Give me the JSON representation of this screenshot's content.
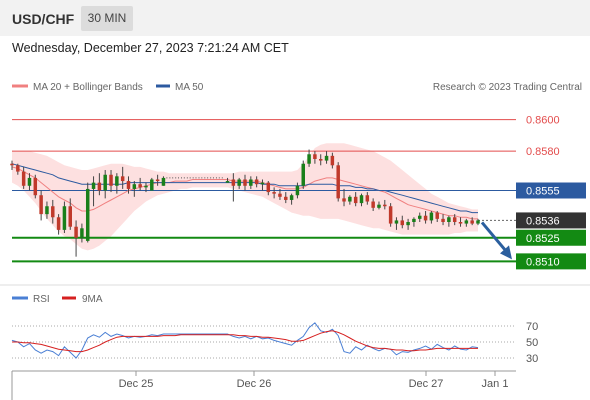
{
  "header": {
    "symbol": "USD/CHF",
    "timeframe": "30 MIN",
    "datetime": "Wednesday, December 27, 2023 7:21:24 AM CET"
  },
  "legend": {
    "bollinger": "MA 20 + Bollinger Bands",
    "ma50": "MA 50",
    "rsi": "RSI",
    "ma9": "9MA"
  },
  "copyright": "Research © 2023 Trading Central",
  "colors": {
    "bollinger": "#f08080",
    "band_fill": "#fde0e0",
    "ma50": "#2c5aa0",
    "support": "#138a13",
    "resistance": "#e34c4c",
    "current": "#333333",
    "candle_up": "#1a7f1a",
    "candle_down": "#c0392b",
    "arrow": "#2b5f9e",
    "rsi": "#4a7fd4",
    "ma9": "#d62020"
  },
  "chart_data": [
    {
      "type": "candlestick",
      "ylim": [
        0.8495,
        0.8615
      ],
      "price_levels": [
        {
          "value": 0.86,
          "label": "0.8600",
          "kind": "resistance"
        },
        {
          "value": 0.858,
          "label": "0.8580",
          "kind": "resistance"
        },
        {
          "value": 0.8555,
          "label": "0.8555",
          "kind": "pivot"
        },
        {
          "value": 0.8536,
          "label": "0.8536",
          "kind": "current"
        },
        {
          "value": 0.8525,
          "label": "0.8525",
          "kind": "support"
        },
        {
          "value": 0.851,
          "label": "0.8510",
          "kind": "support"
        }
      ],
      "x_ticks": [
        "Dec 25",
        "Dec 26",
        "Dec 27",
        "Jan 1"
      ],
      "candles": [
        [
          0.8572,
          0.8574,
          0.8568,
          0.8571
        ],
        [
          0.8571,
          0.8572,
          0.8565,
          0.8567
        ],
        [
          0.8567,
          0.857,
          0.8556,
          0.8558
        ],
        [
          0.8558,
          0.8566,
          0.8555,
          0.8563
        ],
        [
          0.8563,
          0.8565,
          0.855,
          0.8552
        ],
        [
          0.8552,
          0.8555,
          0.8536,
          0.854
        ],
        [
          0.854,
          0.8548,
          0.8537,
          0.8545
        ],
        [
          0.8545,
          0.8549,
          0.8534,
          0.8538
        ],
        [
          0.8538,
          0.854,
          0.8527,
          0.853
        ],
        [
          0.853,
          0.8548,
          0.8528,
          0.8545
        ],
        [
          0.8545,
          0.855,
          0.853,
          0.8532
        ],
        [
          0.8532,
          0.8536,
          0.8513,
          0.8525
        ],
        [
          0.8525,
          0.8534,
          0.8522,
          0.8531
        ],
        [
          0.8523,
          0.856,
          0.8522,
          0.8556
        ],
        [
          0.8556,
          0.8564,
          0.8545,
          0.856
        ],
        [
          0.856,
          0.8566,
          0.8552,
          0.8555
        ],
        [
          0.8555,
          0.8568,
          0.855,
          0.8565
        ],
        [
          0.8565,
          0.8568,
          0.8554,
          0.8558
        ],
        [
          0.8558,
          0.8566,
          0.8553,
          0.8564
        ],
        [
          0.8564,
          0.857,
          0.8556,
          0.8561
        ],
        [
          0.8561,
          0.8564,
          0.8553,
          0.8556
        ],
        [
          0.8556,
          0.8561,
          0.8551,
          0.8559
        ],
        [
          0.8559,
          0.8563,
          0.8555,
          0.8557
        ],
        [
          0.8557,
          0.856,
          0.8554,
          0.8558
        ],
        [
          0.8555,
          0.8563,
          0.8555,
          0.8562
        ],
        [
          0.8562,
          0.8565,
          0.8558,
          0.8561
        ],
        [
          0.8558,
          0.8564,
          0.8558,
          0.8563
        ],
        [
          0.8563,
          0.8563,
          0.8563,
          0.8563
        ],
        [
          0.8563,
          0.8563,
          0.8563,
          0.8563
        ],
        [
          0.8563,
          0.8563,
          0.8563,
          0.8563
        ],
        [
          0.8563,
          0.8563,
          0.8563,
          0.8563
        ],
        [
          0.8563,
          0.8563,
          0.8563,
          0.8563
        ],
        [
          0.8563,
          0.8563,
          0.8563,
          0.8563
        ],
        [
          0.8563,
          0.8563,
          0.8563,
          0.8563
        ],
        [
          0.8563,
          0.8563,
          0.8563,
          0.8563
        ],
        [
          0.8563,
          0.8563,
          0.8563,
          0.8563
        ],
        [
          0.8563,
          0.8563,
          0.8563,
          0.8563
        ],
        [
          0.856,
          0.8563,
          0.856,
          0.8561
        ],
        [
          0.8562,
          0.8566,
          0.8548,
          0.8558
        ],
        [
          0.8558,
          0.8563,
          0.8556,
          0.8562
        ],
        [
          0.8562,
          0.8565,
          0.8555,
          0.8558
        ],
        [
          0.8558,
          0.8564,
          0.8556,
          0.8562
        ],
        [
          0.8562,
          0.8564,
          0.8557,
          0.8559
        ],
        [
          0.8559,
          0.8562,
          0.8555,
          0.856
        ],
        [
          0.856,
          0.8561,
          0.8552,
          0.8554
        ],
        [
          0.8554,
          0.8557,
          0.855,
          0.8553
        ],
        [
          0.8553,
          0.8556,
          0.8549,
          0.8551
        ],
        [
          0.8551,
          0.8554,
          0.8547,
          0.8549
        ],
        [
          0.8549,
          0.8553,
          0.8546,
          0.8552
        ],
        [
          0.8552,
          0.856,
          0.855,
          0.8558
        ],
        [
          0.8558,
          0.8574,
          0.8556,
          0.8572
        ],
        [
          0.8572,
          0.8581,
          0.857,
          0.8578
        ],
        [
          0.8578,
          0.858,
          0.8572,
          0.8575
        ],
        [
          0.8575,
          0.8578,
          0.8571,
          0.8574
        ],
        [
          0.8574,
          0.858,
          0.8572,
          0.8577
        ],
        [
          0.8577,
          0.8579,
          0.8569,
          0.8571
        ],
        [
          0.8571,
          0.8573,
          0.8548,
          0.855
        ],
        [
          0.855,
          0.8556,
          0.8545,
          0.8548
        ],
        [
          0.8548,
          0.8552,
          0.8546,
          0.8551
        ],
        [
          0.8551,
          0.8554,
          0.8545,
          0.8547
        ],
        [
          0.8547,
          0.8553,
          0.8545,
          0.8552
        ],
        [
          0.8552,
          0.8554,
          0.8546,
          0.8548
        ],
        [
          0.8548,
          0.855,
          0.8542,
          0.8544
        ],
        [
          0.8544,
          0.8548,
          0.8543,
          0.8546
        ],
        [
          0.8546,
          0.8549,
          0.8543,
          0.8545
        ],
        [
          0.8545,
          0.8547,
          0.8532,
          0.8534
        ],
        [
          0.8534,
          0.8538,
          0.853,
          0.8536
        ],
        [
          0.8536,
          0.8539,
          0.8531,
          0.8533
        ],
        [
          0.8533,
          0.8537,
          0.853,
          0.8535
        ],
        [
          0.8535,
          0.8538,
          0.8532,
          0.8537
        ],
        [
          0.8537,
          0.8541,
          0.8535,
          0.8539
        ],
        [
          0.8539,
          0.8542,
          0.8534,
          0.8536
        ],
        [
          0.8536,
          0.8542,
          0.8534,
          0.8541
        ],
        [
          0.8541,
          0.8542,
          0.8535,
          0.8537
        ],
        [
          0.8537,
          0.854,
          0.8533,
          0.8535
        ],
        [
          0.8535,
          0.8539,
          0.8532,
          0.8538
        ],
        [
          0.8538,
          0.854,
          0.8533,
          0.8535
        ],
        [
          0.8535,
          0.8538,
          0.8532,
          0.8534
        ],
        [
          0.8534,
          0.8537,
          0.8532,
          0.8536
        ],
        [
          0.8536,
          0.8538,
          0.8533,
          0.8534
        ],
        [
          0.8534,
          0.8537,
          0.8533,
          0.8536
        ]
      ],
      "ma50": [
        0.8572,
        0.8571,
        0.857,
        0.8569,
        0.8568,
        0.8567,
        0.8566,
        0.8565,
        0.8563,
        0.8562,
        0.8561,
        0.856,
        0.8559,
        0.8559,
        0.8559,
        0.8559,
        0.8559,
        0.8559,
        0.8559,
        0.8559,
        0.856,
        0.856,
        0.856,
        0.856,
        0.856,
        0.856,
        0.856,
        0.856,
        0.856,
        0.856,
        0.856,
        0.856,
        0.856,
        0.856,
        0.856,
        0.856,
        0.856,
        0.856,
        0.856,
        0.856,
        0.856,
        0.856,
        0.856,
        0.8559,
        0.8559,
        0.8559,
        0.8558,
        0.8558,
        0.8558,
        0.8558,
        0.8558,
        0.8559,
        0.8559,
        0.8559,
        0.8559,
        0.8559,
        0.8558,
        0.8558,
        0.8558,
        0.8557,
        0.8557,
        0.8556,
        0.8556,
        0.8555,
        0.8555,
        0.8554,
        0.8553,
        0.8552,
        0.8551,
        0.855,
        0.8549,
        0.8548,
        0.8547,
        0.8546,
        0.8545,
        0.8544,
        0.8543,
        0.8542,
        0.8542,
        0.8541,
        0.8541
      ],
      "ma20": [
        0.857,
        0.8569,
        0.8567,
        0.8565,
        0.8563,
        0.856,
        0.8557,
        0.8554,
        0.8551,
        0.8549,
        0.8547,
        0.8544,
        0.8542,
        0.8542,
        0.8543,
        0.8545,
        0.8547,
        0.8549,
        0.8551,
        0.8553,
        0.8555,
        0.8556,
        0.8557,
        0.8558,
        0.8559,
        0.856,
        0.856,
        0.856,
        0.8561,
        0.8561,
        0.8561,
        0.8562,
        0.8562,
        0.8562,
        0.8562,
        0.8562,
        0.8562,
        0.8562,
        0.8561,
        0.8561,
        0.8561,
        0.8561,
        0.8561,
        0.856,
        0.8559,
        0.8558,
        0.8557,
        0.8556,
        0.8556,
        0.8556,
        0.8557,
        0.8559,
        0.8561,
        0.8562,
        0.8563,
        0.8563,
        0.8562,
        0.8561,
        0.856,
        0.8559,
        0.8558,
        0.8557,
        0.8556,
        0.8555,
        0.8554,
        0.8552,
        0.855,
        0.8548,
        0.8546,
        0.8545,
        0.8544,
        0.8543,
        0.8542,
        0.8541,
        0.854,
        0.8539,
        0.8539,
        0.8538,
        0.8538,
        0.8537,
        0.8537
      ],
      "bb_upper": [
        0.858,
        0.858,
        0.858,
        0.858,
        0.8579,
        0.8578,
        0.8577,
        0.8575,
        0.8573,
        0.8571,
        0.857,
        0.8569,
        0.8568,
        0.8568,
        0.8569,
        0.857,
        0.8571,
        0.8572,
        0.8572,
        0.8572,
        0.8571,
        0.857,
        0.857,
        0.8569,
        0.8568,
        0.8567,
        0.8567,
        0.8566,
        0.8566,
        0.8566,
        0.8566,
        0.8566,
        0.8566,
        0.8566,
        0.8566,
        0.8566,
        0.8566,
        0.8566,
        0.8566,
        0.8567,
        0.8567,
        0.8567,
        0.8567,
        0.8567,
        0.8567,
        0.8567,
        0.8567,
        0.8567,
        0.8567,
        0.8568,
        0.8572,
        0.8577,
        0.8582,
        0.8584,
        0.8585,
        0.8585,
        0.8585,
        0.8585,
        0.8584,
        0.8583,
        0.8582,
        0.8581,
        0.858,
        0.8578,
        0.8576,
        0.8574,
        0.8571,
        0.8568,
        0.8565,
        0.8562,
        0.8559,
        0.8556,
        0.8553,
        0.8551,
        0.8549,
        0.8547,
        0.8546,
        0.8545,
        0.8544,
        0.8543,
        0.8543
      ],
      "bb_lower": [
        0.856,
        0.8558,
        0.8555,
        0.8551,
        0.8547,
        0.8542,
        0.8537,
        0.8533,
        0.8529,
        0.8526,
        0.8524,
        0.8521,
        0.8518,
        0.8517,
        0.8518,
        0.852,
        0.8523,
        0.8526,
        0.853,
        0.8534,
        0.8538,
        0.8542,
        0.8545,
        0.8548,
        0.855,
        0.8552,
        0.8553,
        0.8554,
        0.8555,
        0.8556,
        0.8556,
        0.8557,
        0.8557,
        0.8557,
        0.8557,
        0.8557,
        0.8557,
        0.8557,
        0.8556,
        0.8555,
        0.8554,
        0.8553,
        0.8552,
        0.8551,
        0.8549,
        0.8547,
        0.8545,
        0.8543,
        0.8541,
        0.854,
        0.8539,
        0.8539,
        0.8538,
        0.8537,
        0.8537,
        0.8537,
        0.8537,
        0.8536,
        0.8535,
        0.8534,
        0.8533,
        0.8532,
        0.8531,
        0.8531,
        0.853,
        0.8529,
        0.8528,
        0.8527,
        0.8527,
        0.8527,
        0.8527,
        0.8527,
        0.8527,
        0.8527,
        0.8527,
        0.8527,
        0.8528,
        0.8528,
        0.8529,
        0.8529,
        0.8529
      ],
      "forecast": {
        "from": 0.8536,
        "to": 0.851
      }
    },
    {
      "type": "line",
      "ylim": [
        20,
        80
      ],
      "y_ticks": [
        70,
        50,
        30
      ],
      "series": [
        {
          "name": "RSI",
          "values": [
            52,
            50,
            44,
            48,
            40,
            36,
            40,
            38,
            33,
            44,
            37,
            30,
            40,
            55,
            59,
            56,
            62,
            57,
            60,
            58,
            55,
            57,
            56,
            57,
            59,
            58,
            60,
            60,
            60,
            60,
            60,
            60,
            60,
            60,
            60,
            60,
            60,
            60,
            57,
            55,
            57,
            54,
            57,
            54,
            55,
            52,
            50,
            48,
            46,
            52,
            57,
            68,
            74,
            64,
            62,
            66,
            58,
            38,
            36,
            44,
            40,
            46,
            42,
            39,
            42,
            41,
            34,
            38,
            37,
            40,
            42,
            45,
            41,
            47,
            43,
            40,
            45,
            41,
            40,
            44,
            43
          ]
        },
        {
          "name": "9MA",
          "values": [
            50,
            50,
            49,
            49,
            48,
            47,
            45,
            43,
            41,
            40,
            39,
            38,
            38,
            40,
            43,
            46,
            50,
            53,
            56,
            57,
            57,
            57,
            57,
            57,
            57,
            57,
            58,
            58,
            58,
            59,
            59,
            59,
            59,
            59,
            59,
            59,
            59,
            59,
            59,
            58,
            58,
            57,
            57,
            56,
            56,
            55,
            54,
            53,
            51,
            51,
            52,
            55,
            58,
            61,
            63,
            64,
            62,
            59,
            55,
            51,
            48,
            45,
            43,
            42,
            42,
            41,
            40,
            40,
            39,
            39,
            40,
            40,
            41,
            42,
            42,
            42,
            42,
            42,
            42,
            42,
            42
          ]
        }
      ]
    }
  ]
}
